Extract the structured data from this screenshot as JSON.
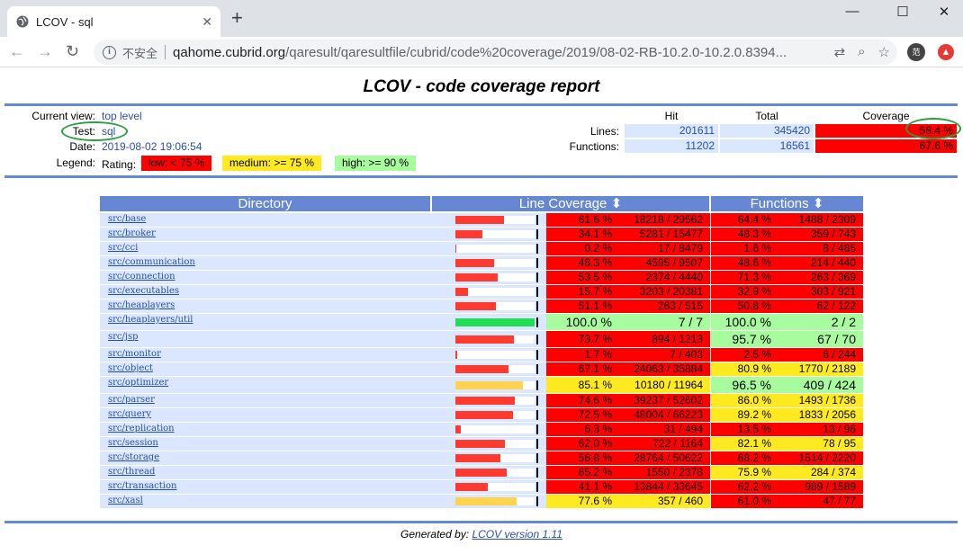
{
  "browser": {
    "tab_title": "LCOV - sql",
    "insecure_label": "不安全",
    "url_host": "qahome.cubrid.org",
    "url_path": "/qaresult/qaresultfile/cubrid/code%20coverage/2019/08-02-RB-10.2.0-10.2.0.8394...",
    "avatar_label": "范"
  },
  "page": {
    "title": "LCOV - code coverage report",
    "current_view_label": "Current view:",
    "current_view_value": "top level",
    "test_label": "Test:",
    "test_value": "sql",
    "date_label": "Date:",
    "date_value": "2019-08-02 19:06:54",
    "legend_label": "Legend:",
    "rating_label": "Rating:",
    "legend_low": "low: < 75 %",
    "legend_medium": "medium: >= 75 %",
    "legend_high": "high: >= 90 %",
    "footer_prefix": "Generated by: ",
    "footer_link": "LCOV version 1.11"
  },
  "summary": {
    "col_hit": "Hit",
    "col_total": "Total",
    "col_coverage": "Coverage",
    "lines_label": "Lines:",
    "lines_hit": "201611",
    "lines_total": "345420",
    "lines_cov": "58.4 %",
    "functions_label": "Functions:",
    "functions_hit": "11202",
    "functions_total": "16561",
    "functions_cov": "67.6 %"
  },
  "table": {
    "col_directory": "Directory",
    "col_line": "Line Coverage",
    "col_functions": "Functions",
    "sort_icon": "⬍"
  },
  "colors": {
    "low": "#ff0000",
    "medium": "#ffea20",
    "high": "#a7fc9d",
    "bar_low": "#ff3b30",
    "bar_medium": "#ffd34d",
    "bar_high": "#22dd55",
    "header_blue": "#6688d4"
  },
  "rows": [
    {
      "dir": "src/base",
      "lpct": "61.6 %",
      "lval": 61.6,
      "lnum": "18218 / 29562",
      "lrate": "low",
      "fpct": "64.4 %",
      "fnum": "1488 / 2309",
      "frate": "low"
    },
    {
      "dir": "src/broker",
      "lpct": "34.1 %",
      "lval": 34.1,
      "lnum": "5281 / 15477",
      "lrate": "low",
      "fpct": "48.3 %",
      "fnum": "359 / 743",
      "frate": "low"
    },
    {
      "dir": "src/cci",
      "lpct": "0.2 %",
      "lval": 0.2,
      "lnum": "17 / 8479",
      "lrate": "low",
      "fpct": "1.6 %",
      "fnum": "8 / 485",
      "frate": "low"
    },
    {
      "dir": "src/communication",
      "lpct": "48.3 %",
      "lval": 48.3,
      "lnum": "4595 / 9507",
      "lrate": "low",
      "fpct": "48.6 %",
      "fnum": "214 / 440",
      "frate": "low"
    },
    {
      "dir": "src/connection",
      "lpct": "53.5 %",
      "lval": 53.5,
      "lnum": "2374 / 4440",
      "lrate": "low",
      "fpct": "71.3 %",
      "fnum": "263 / 369",
      "frate": "low"
    },
    {
      "dir": "src/executables",
      "lpct": "15.7 %",
      "lval": 15.7,
      "lnum": "3203 / 20381",
      "lrate": "low",
      "fpct": "32.9 %",
      "fnum": "303 / 921",
      "frate": "low"
    },
    {
      "dir": "src/heaplayers",
      "lpct": "51.1 %",
      "lval": 51.1,
      "lnum": "263 / 515",
      "lrate": "low",
      "fpct": "50.8 %",
      "fnum": "62 / 122",
      "frate": "low"
    },
    {
      "dir": "src/heaplayers/util",
      "lpct": "100.0 %",
      "lval": 100.0,
      "lnum": "7 / 7",
      "lrate": "high",
      "fpct": "100.0 %",
      "fnum": "2 / 2",
      "frate": "high"
    },
    {
      "dir": "src/jsp",
      "lpct": "73.7 %",
      "lval": 73.7,
      "lnum": "894 / 1213",
      "lrate": "low",
      "fpct": "95.7 %",
      "fnum": "67 / 70",
      "frate": "high"
    },
    {
      "dir": "src/monitor",
      "lpct": "1.7 %",
      "lval": 1.7,
      "lnum": "7 / 403",
      "lrate": "low",
      "fpct": "2.5 %",
      "fnum": "6 / 244",
      "frate": "low"
    },
    {
      "dir": "src/object",
      "lpct": "67.1 %",
      "lval": 67.1,
      "lnum": "24063 / 35884",
      "lrate": "low",
      "fpct": "80.9 %",
      "fnum": "1770 / 2189",
      "frate": "medium"
    },
    {
      "dir": "src/optimizer",
      "lpct": "85.1 %",
      "lval": 85.1,
      "lnum": "10180 / 11964",
      "lrate": "medium",
      "fpct": "96.5 %",
      "fnum": "409 / 424",
      "frate": "high"
    },
    {
      "dir": "src/parser",
      "lpct": "74.6 %",
      "lval": 74.6,
      "lnum": "39237 / 52602",
      "lrate": "low",
      "fpct": "86.0 %",
      "fnum": "1493 / 1736",
      "frate": "medium"
    },
    {
      "dir": "src/query",
      "lpct": "72.5 %",
      "lval": 72.5,
      "lnum": "48004 / 66223",
      "lrate": "low",
      "fpct": "89.2 %",
      "fnum": "1833 / 2056",
      "frate": "medium"
    },
    {
      "dir": "src/replication",
      "lpct": "6.3 %",
      "lval": 6.3,
      "lnum": "31 / 494",
      "lrate": "low",
      "fpct": "13.5 %",
      "fnum": "13 / 96",
      "frate": "low"
    },
    {
      "dir": "src/session",
      "lpct": "62.0 %",
      "lval": 62.0,
      "lnum": "722 / 1164",
      "lrate": "low",
      "fpct": "82.1 %",
      "fnum": "78 / 95",
      "frate": "medium"
    },
    {
      "dir": "src/storage",
      "lpct": "56.8 %",
      "lval": 56.8,
      "lnum": "28764 / 50622",
      "lrate": "low",
      "fpct": "68.2 %",
      "fnum": "1514 / 2220",
      "frate": "low"
    },
    {
      "dir": "src/thread",
      "lpct": "65.2 %",
      "lval": 65.2,
      "lnum": "1550 / 2378",
      "lrate": "low",
      "fpct": "75.9 %",
      "fnum": "284 / 374",
      "frate": "medium"
    },
    {
      "dir": "src/transaction",
      "lpct": "41.1 %",
      "lval": 41.1,
      "lnum": "13844 / 33645",
      "lrate": "low",
      "fpct": "62.2 %",
      "fnum": "989 / 1589",
      "frate": "low"
    },
    {
      "dir": "src/xasl",
      "lpct": "77.6 %",
      "lval": 77.6,
      "lnum": "357 / 460",
      "lrate": "medium",
      "fpct": "61.0 %",
      "fnum": "47 / 77",
      "frate": "low"
    }
  ]
}
